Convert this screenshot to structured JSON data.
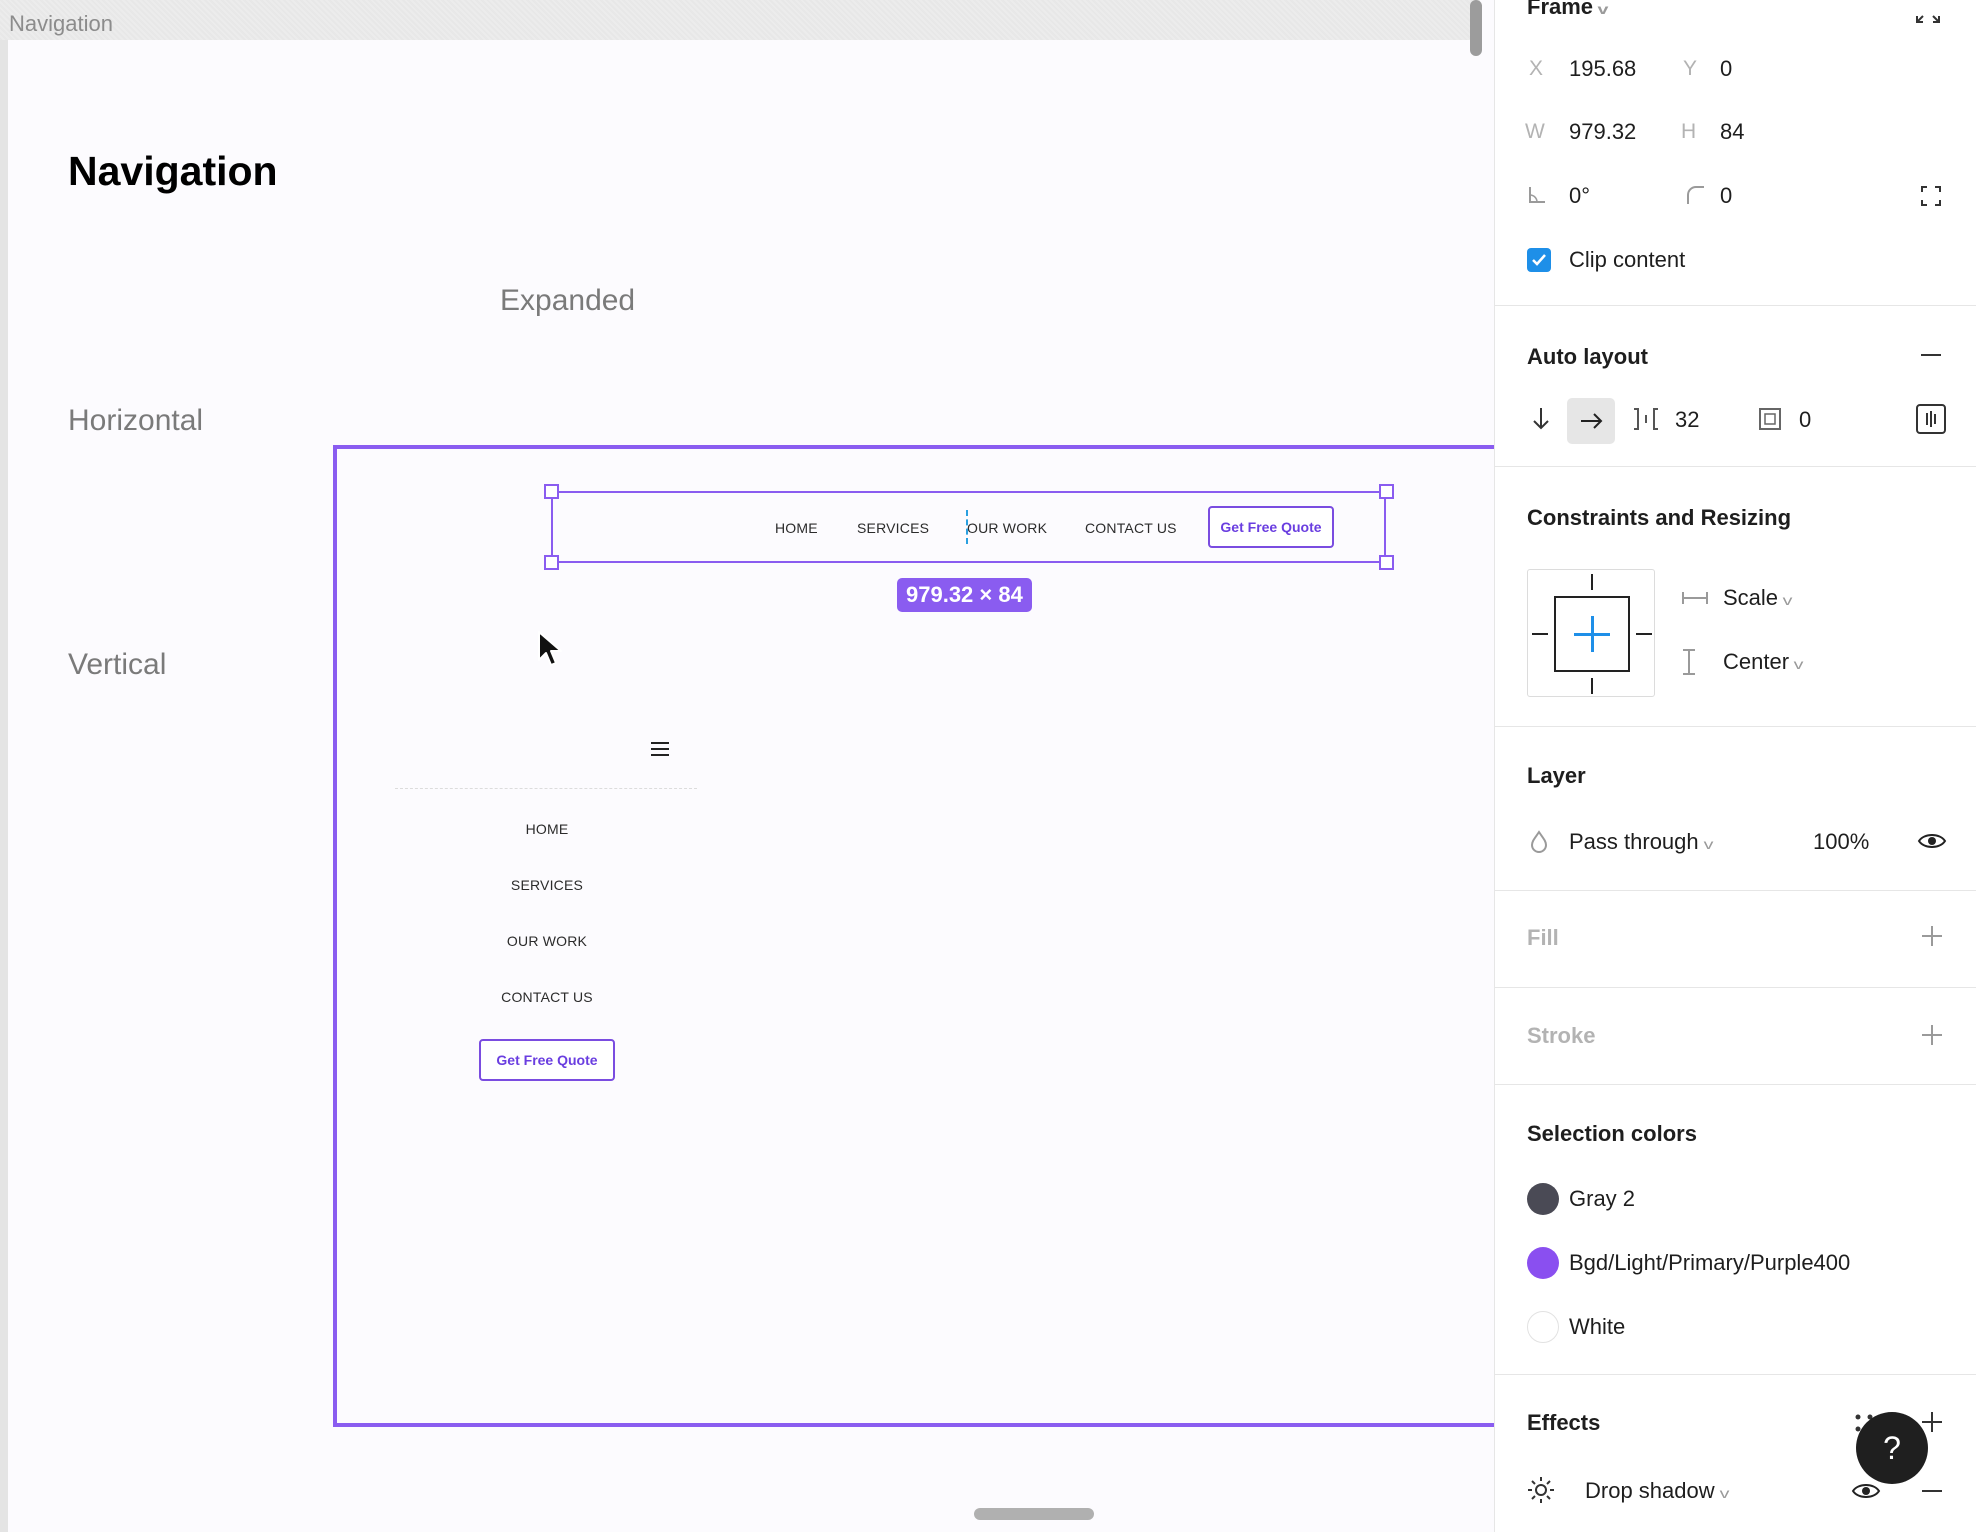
{
  "canvas": {
    "frame_label": "Navigation",
    "page_title": "Navigation",
    "labels": {
      "expanded": "Expanded",
      "horizontal": "Horizontal",
      "vertical": "Vertical"
    },
    "horizontal_nav": {
      "links": [
        "HOME",
        "SERVICES",
        "OUR WORK",
        "CONTACT US"
      ],
      "cta": "Get Free Quote"
    },
    "size_badge": "979.32 × 84",
    "vertical_nav": {
      "links": [
        "HOME",
        "SERVICES",
        "OUR WORK",
        "CONTACT US"
      ],
      "cta": "Get Free Quote"
    }
  },
  "panel": {
    "frame": {
      "title": "Frame",
      "x_label": "X",
      "x": "195.68",
      "y_label": "Y",
      "y": "0",
      "w_label": "W",
      "w": "979.32",
      "h_label": "H",
      "h": "84",
      "rotation": "0°",
      "radius": "0",
      "clip_content": "Clip content"
    },
    "auto_layout": {
      "title": "Auto layout",
      "spacing": "32",
      "padding": "0"
    },
    "constraints": {
      "title": "Constraints and Resizing",
      "horizontal": "Scale",
      "vertical": "Center"
    },
    "layer": {
      "title": "Layer",
      "blend": "Pass through",
      "opacity": "100%"
    },
    "fill": {
      "title": "Fill"
    },
    "stroke": {
      "title": "Stroke"
    },
    "selection_colors": {
      "title": "Selection colors",
      "items": [
        {
          "name": "Gray 2",
          "color": "#4a4a55"
        },
        {
          "name": "Bgd/Light/Primary/Purple400",
          "color": "#8a4ff0"
        },
        {
          "name": "White",
          "color": "#ffffff"
        }
      ]
    },
    "effects": {
      "title": "Effects",
      "items": [
        {
          "name": "Drop shadow"
        }
      ]
    },
    "help": "?"
  },
  "colors": {
    "selection": "#8a5cf0",
    "accent": "#1e8fe8",
    "cta": "#6a3ee0"
  }
}
